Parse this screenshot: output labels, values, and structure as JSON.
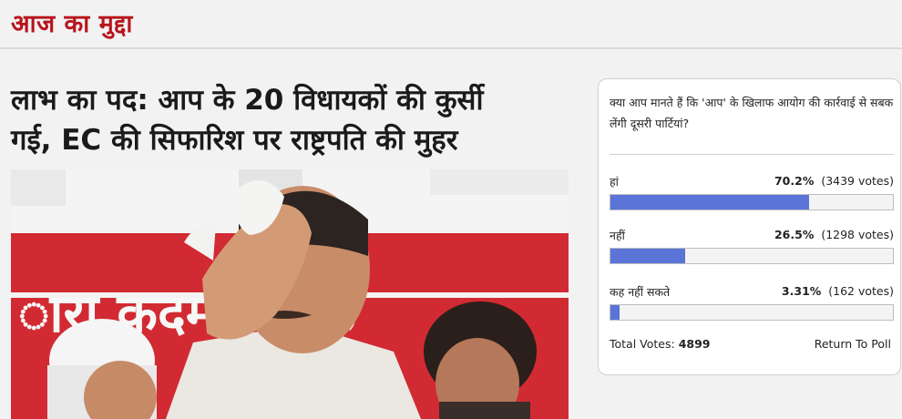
{
  "section": {
    "title": "आज का मुद्दा"
  },
  "article": {
    "headline_line1": "लाभ का पद: आप के 20 विधायकों की कुर्सी",
    "headline_line2": "गई, EC की सिफारिश पर राष्ट्रपति की मुहर",
    "banner_text": "ारा  कदम  ार  क"
  },
  "poll": {
    "question": "क्या आप मानते हैं कि 'आप' के खिलाफ आयोग की कार्रवाई से सबक लेंगी दूसरी पार्टियां?",
    "options": [
      {
        "label": "हां",
        "percent": "70.2%",
        "votes": "(3439 votes)",
        "fraction": 0.702
      },
      {
        "label": "नहीं",
        "percent": "26.5%",
        "votes": "(1298 votes)",
        "fraction": 0.265
      },
      {
        "label": "कह नहीं सकते",
        "percent": "3.31%",
        "votes": "(162 votes)",
        "fraction": 0.0331
      }
    ],
    "total_label": "Total Votes:",
    "total_value": "4899",
    "return_label": "Return To Poll",
    "bar_color": "#5b74d8"
  },
  "colors": {
    "brand_red": "#b8141b"
  }
}
